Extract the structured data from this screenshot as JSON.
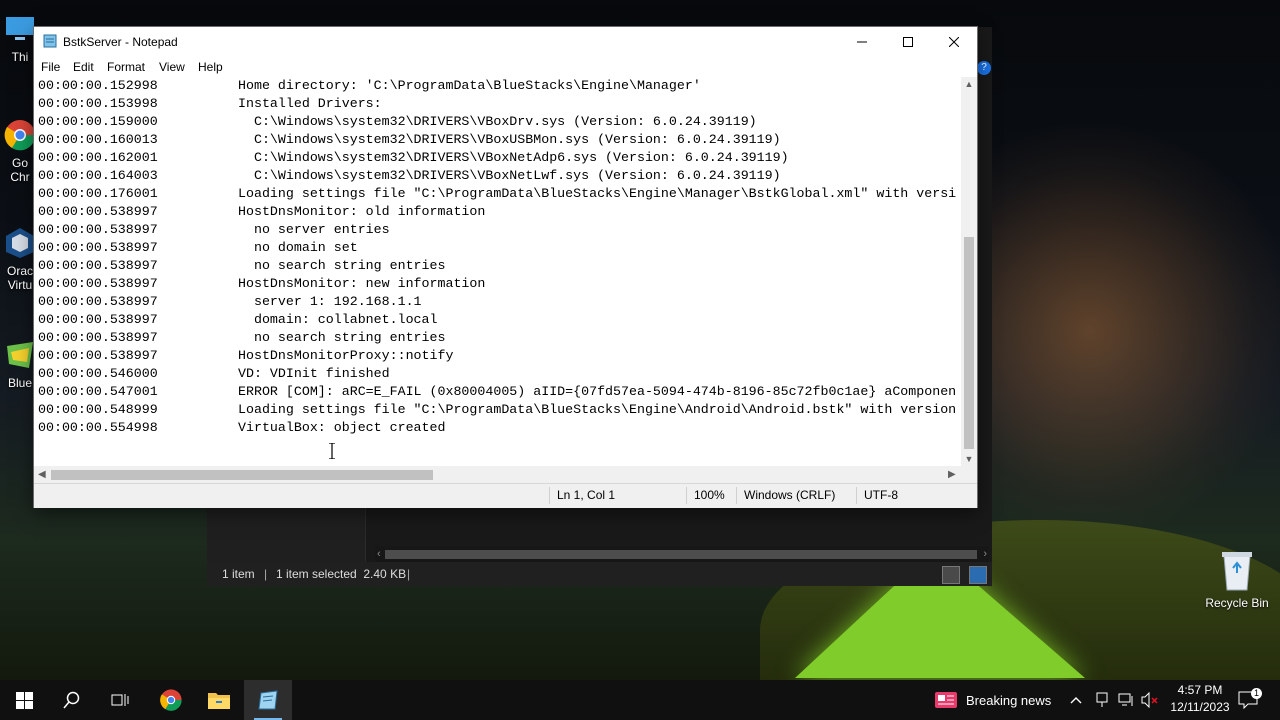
{
  "window": {
    "title": "BstkServer - Notepad",
    "menu": [
      "File",
      "Edit",
      "Format",
      "View",
      "Help"
    ]
  },
  "log_lines": [
    {
      "ts": "00:00:00.152998",
      "text": "Home directory: 'C:\\ProgramData\\BlueStacks\\Engine\\Manager'"
    },
    {
      "ts": "00:00:00.153998",
      "text": "Installed Drivers:"
    },
    {
      "ts": "00:00:00.159000",
      "text": "  C:\\Windows\\system32\\DRIVERS\\VBoxDrv.sys (Version: 6.0.24.39119)"
    },
    {
      "ts": "00:00:00.160013",
      "text": "  C:\\Windows\\system32\\DRIVERS\\VBoxUSBMon.sys (Version: 6.0.24.39119)"
    },
    {
      "ts": "00:00:00.162001",
      "text": "  C:\\Windows\\system32\\DRIVERS\\VBoxNetAdp6.sys (Version: 6.0.24.39119)"
    },
    {
      "ts": "00:00:00.164003",
      "text": "  C:\\Windows\\system32\\DRIVERS\\VBoxNetLwf.sys (Version: 6.0.24.39119)"
    },
    {
      "ts": "00:00:00.176001",
      "text": "Loading settings file \"C:\\ProgramData\\BlueStacks\\Engine\\Manager\\BstkGlobal.xml\" with versi"
    },
    {
      "ts": "00:00:00.538997",
      "text": "HostDnsMonitor: old information"
    },
    {
      "ts": "00:00:00.538997",
      "text": "  no server entries"
    },
    {
      "ts": "00:00:00.538997",
      "text": "  no domain set"
    },
    {
      "ts": "00:00:00.538997",
      "text": "  no search string entries"
    },
    {
      "ts": "00:00:00.538997",
      "text": "HostDnsMonitor: new information"
    },
    {
      "ts": "00:00:00.538997",
      "text": "  server 1: 192.168.1.1"
    },
    {
      "ts": "00:00:00.538997",
      "text": "  domain: collabnet.local"
    },
    {
      "ts": "00:00:00.538997",
      "text": "  no search string entries"
    },
    {
      "ts": "00:00:00.538997",
      "text": "HostDnsMonitorProxy::notify"
    },
    {
      "ts": "00:00:00.546000",
      "text": "VD: VDInit finished"
    },
    {
      "ts": "00:00:00.547001",
      "text": "ERROR [COM]: aRC=E_FAIL (0x80004005) aIID={07fd57ea-5094-474b-8196-85c72fb0c1ae} aComponen"
    },
    {
      "ts": "00:00:00.548999",
      "text": "Loading settings file \"C:\\ProgramData\\BlueStacks\\Engine\\Android\\Android.bstk\" with version"
    },
    {
      "ts": "00:00:00.554998",
      "text": "VirtualBox: object created"
    }
  ],
  "status": {
    "position": "Ln 1, Col 1",
    "zoom": "100%",
    "line_endings": "Windows (CRLF)",
    "encoding": "UTF-8"
  },
  "explorer_status": {
    "items": "1 item",
    "selected": "1 item selected  2.40 KB"
  },
  "desktop_icons": [
    {
      "label": "Thi",
      "icon": "this-pc-icon"
    },
    {
      "label": "Go\nChr",
      "icon": "chrome-icon"
    },
    {
      "label": "Orac\nVirtu",
      "icon": "virtualbox-icon"
    },
    {
      "label": "Blue",
      "icon": "bluestacks-icon"
    }
  ],
  "recycle_bin": {
    "label": "Recycle Bin"
  },
  "taskbar": {
    "news": "Breaking news",
    "time": "4:57 PM",
    "date": "12/11/2023",
    "notification_count": "1"
  },
  "colors": {
    "taskbar": "#101010",
    "active_underline": "#76b9ed",
    "tent_green": "#7fcc2b"
  }
}
